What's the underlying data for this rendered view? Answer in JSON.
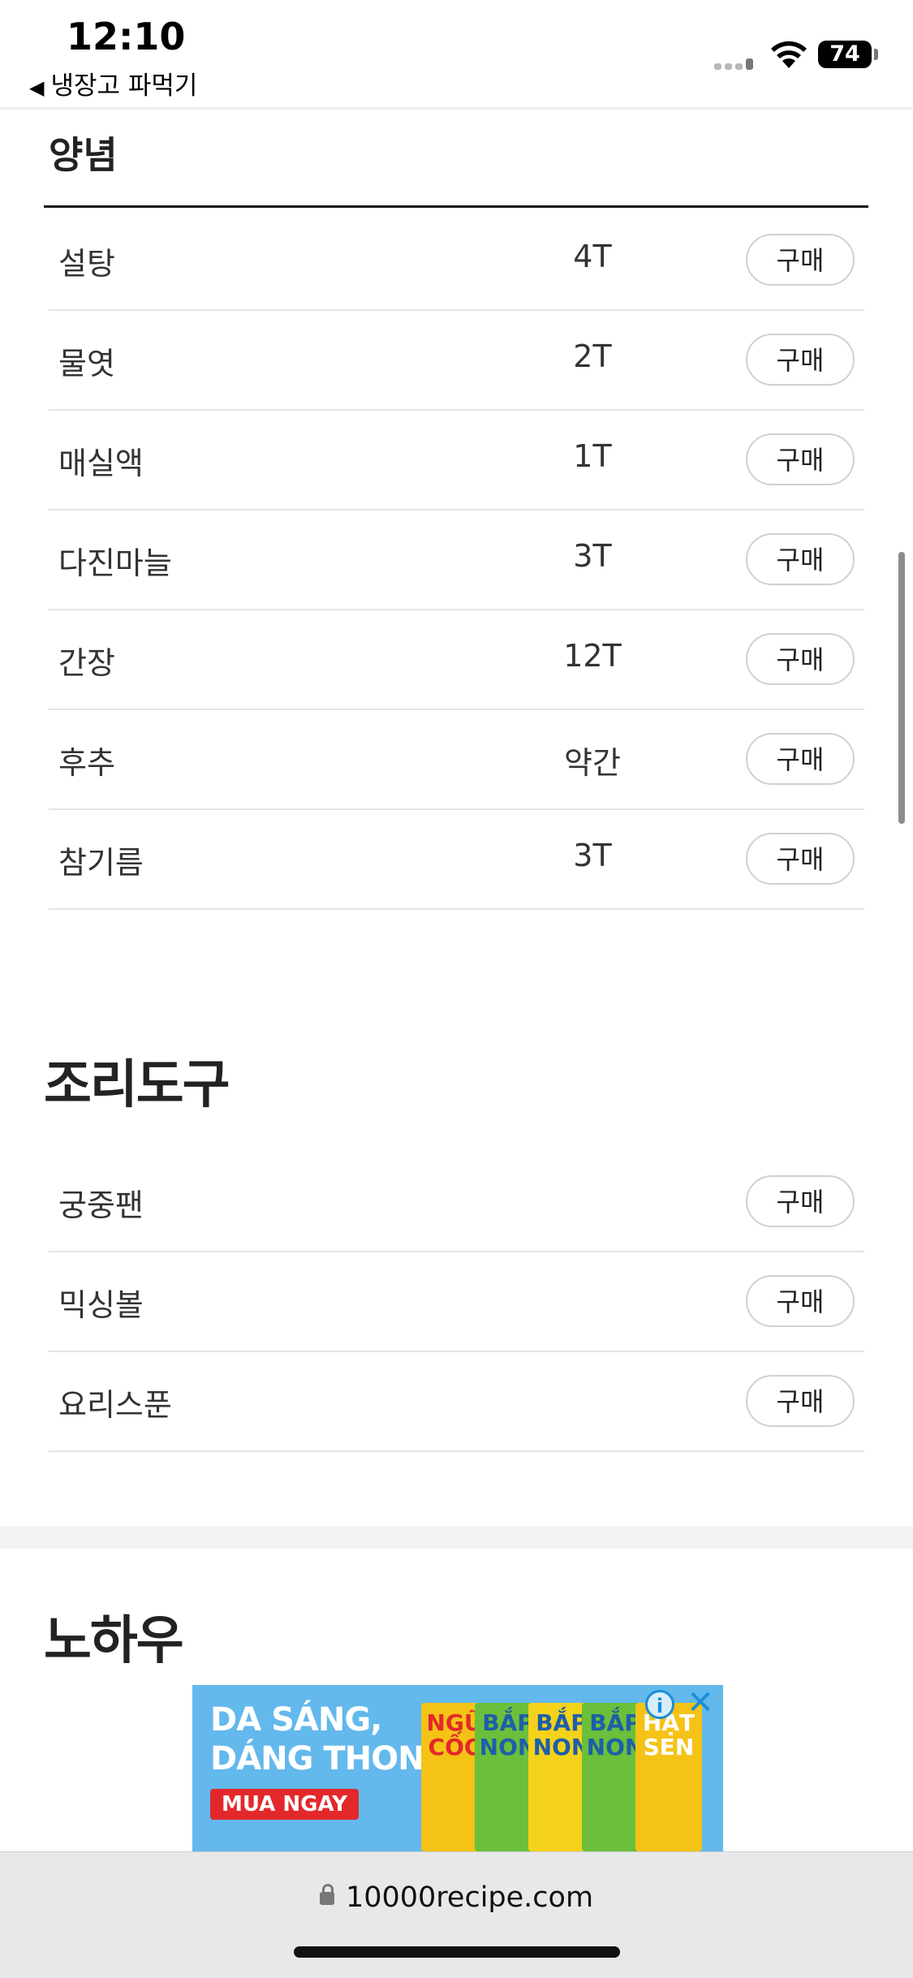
{
  "status": {
    "time": "12:10",
    "back_app": "냉장고 파먹기",
    "battery": "74"
  },
  "seasoning": {
    "title": "양념",
    "items": [
      {
        "name": "설탕",
        "amount": "4T",
        "button": "구매"
      },
      {
        "name": "물엿",
        "amount": "2T",
        "button": "구매"
      },
      {
        "name": "매실액",
        "amount": "1T",
        "button": "구매"
      },
      {
        "name": "다진마늘",
        "amount": "3T",
        "button": "구매"
      },
      {
        "name": "간장",
        "amount": "12T",
        "button": "구매"
      },
      {
        "name": "후추",
        "amount": "약간",
        "button": "구매"
      },
      {
        "name": "참기름",
        "amount": "3T",
        "button": "구매"
      }
    ]
  },
  "tools": {
    "title": "조리도구",
    "items": [
      {
        "name": "궁중팬",
        "button": "구매"
      },
      {
        "name": "믹싱볼",
        "button": "구매"
      },
      {
        "name": "요리스푼",
        "button": "구매"
      }
    ]
  },
  "knowhow": {
    "title": "노하우"
  },
  "ad": {
    "line1": "DA SÁNG,",
    "line2": "DÁNG THON",
    "cta": "MUA NGAY",
    "packs": [
      "NGŨ CỐC",
      "BẮP NON",
      "BẮP NON",
      "BẮP NON",
      "HẠT SEN"
    ],
    "info_icon": "i",
    "close_icon": "✕"
  },
  "browser": {
    "url": "10000recipe.com"
  }
}
